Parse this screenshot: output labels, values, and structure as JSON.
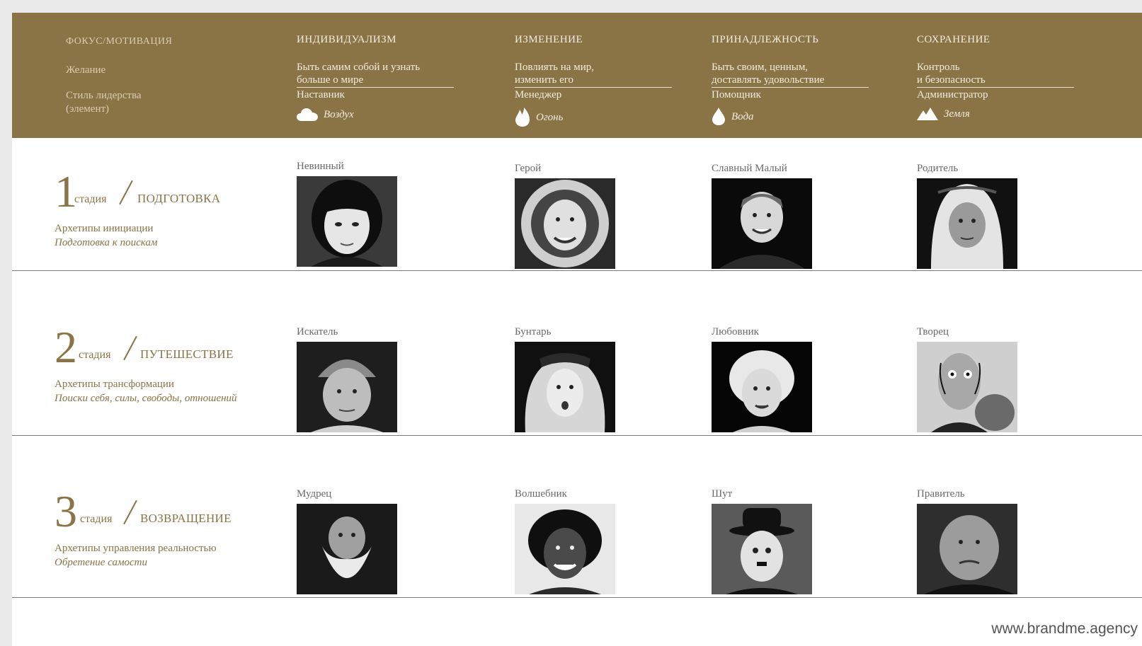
{
  "header": {
    "labels": {
      "focus": "ФОКУС/МОТИВАЦИЯ",
      "desire": "Желание",
      "leadership": "Стиль лидерства",
      "element": "(элемент)"
    },
    "columns": [
      {
        "title": "ИНДИВИДУАЛИЗМ",
        "desire1": "Быть самим собой и узнать",
        "desire2": "больше о мире",
        "role": "Наставник",
        "element": "Воздух",
        "icon": "cloud-icon"
      },
      {
        "title": "ИЗМЕНЕНИЕ",
        "desire1": "Повлиять на мир,",
        "desire2": "изменить его",
        "role": "Менеджер",
        "element": "Огонь",
        "icon": "fire-icon"
      },
      {
        "title": "ПРИНАДЛЕЖНОСТЬ",
        "desire1": "Быть своим, ценным,",
        "desire2": "доставлять удовольствие",
        "role": "Помощник",
        "element": "Вода",
        "icon": "water-drop-icon"
      },
      {
        "title": "СОХРАНЕНИЕ",
        "desire1": "Контроль",
        "desire2": "и безопасность",
        "role": "Администратор",
        "element": "Земля",
        "icon": "mountain-icon"
      }
    ]
  },
  "stages": [
    {
      "number": "1",
      "word": "стадия",
      "name": "ПОДГОТОВКА",
      "subtitle": "Архетипы инициации",
      "subtitle_italic": "Подготовка к поискам",
      "archetypes": [
        "Невинный",
        "Герой",
        "Славный Малый",
        "Родитель"
      ]
    },
    {
      "number": "2",
      "word": "стадия",
      "name": "ПУТЕШЕСТВИЕ",
      "subtitle": "Архетипы трансформации",
      "subtitle_italic": "Поиски себя, силы, свободы, отношений",
      "archetypes": [
        "Искатель",
        "Бунтарь",
        "Любовник",
        "Творец"
      ]
    },
    {
      "number": "3",
      "word": "стадия",
      "name": "ВОЗВРАЩЕНИЕ",
      "subtitle": "Архетипы управления реальностью",
      "subtitle_italic": "Обретение самости",
      "archetypes": [
        "Мудрец",
        "Волшебник",
        "Шут",
        "Правитель"
      ]
    }
  ],
  "footer": {
    "url": "www.brandme.agency"
  },
  "colors": {
    "band": "#8a7345",
    "accent": "#8a7345",
    "text_gray": "#6a6a6a"
  }
}
